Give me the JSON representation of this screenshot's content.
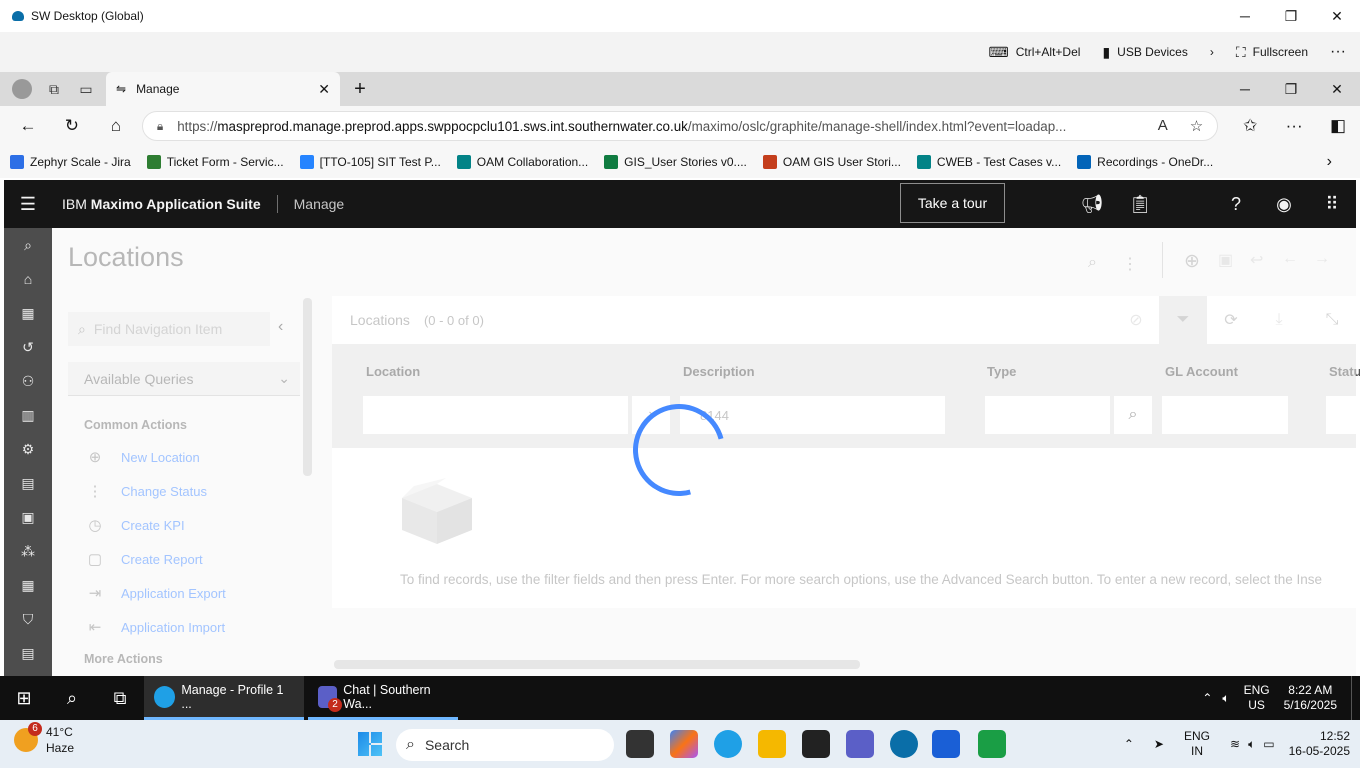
{
  "outer_window": {
    "title": "SW Desktop (Global)",
    "minimize": "─",
    "restore": "❐",
    "close": "✕"
  },
  "remote_bar": {
    "ctrl_alt_del": "Ctrl+Alt+Del",
    "usb": "USB Devices",
    "fullscreen": "Fullscreen",
    "more": "···"
  },
  "browser": {
    "tab_title": "Manage",
    "new_tab": "+",
    "url_host": "maspreprod.manage.preprod.apps.swppocpclu101.sws.int.southernwater.co.uk",
    "url_prefix": "https://",
    "url_path": "/maximo/oslc/graphite/manage-shell/index.html?event=loadap...",
    "bookmarks": [
      {
        "label": "Zephyr Scale - Jira",
        "color": "#2d6fe6"
      },
      {
        "label": "Ticket Form - Servic...",
        "color": "#2e7d32"
      },
      {
        "label": "[TTO-105] SIT Test P...",
        "color": "#2684ff"
      },
      {
        "label": "OAM Collaboration...",
        "color": "#038387"
      },
      {
        "label": "GIS_User Stories v0....",
        "color": "#107c41"
      },
      {
        "label": "OAM GIS User Stori...",
        "color": "#c43e1c"
      },
      {
        "label": "CWEB - Test Cases v...",
        "color": "#038387"
      },
      {
        "label": "Recordings - OneDr...",
        "color": "#0364b8"
      }
    ]
  },
  "maximo": {
    "brand_light": "IBM ",
    "brand_bold": "Maximo Application Suite",
    "app_name": "Manage",
    "tour": "Take a tour",
    "page_title": "Locations",
    "find_nav_placeholder": "Find Navigation Item",
    "available_queries": "Available Queries",
    "common_actions_title": "Common Actions",
    "common_actions": [
      "New Location",
      "Change Status",
      "Create KPI",
      "Create Report",
      "Application Export",
      "Application Import"
    ],
    "more_actions_title": "More Actions",
    "table_title": "Locations",
    "table_count": "(0 - 0 of 0)",
    "columns": [
      "Location",
      "Description",
      "Type",
      "GL Account",
      "Statu"
    ],
    "description_filter_value": "8144",
    "empty_message": "To find records, use the filter fields and then press Enter. For more search options, use the Advanced Search button. To enter a new record, select the Inse"
  },
  "remote_taskbar": {
    "apps": [
      {
        "label": "Manage - Profile 1 ...",
        "color": "#1fa0e6"
      },
      {
        "label": "Chat | Southern Wa...",
        "color": "#5b5fc7"
      }
    ],
    "chat_badge": "2",
    "lang": "ENG",
    "region": "US",
    "time": "8:22 AM",
    "date": "5/16/2025"
  },
  "local_taskbar": {
    "temp": "41°C",
    "condition": "Haze",
    "weather_badge": "6",
    "search": "Search",
    "lang": "ENG",
    "region": "IN",
    "time": "12:52",
    "date": "16-05-2025"
  }
}
